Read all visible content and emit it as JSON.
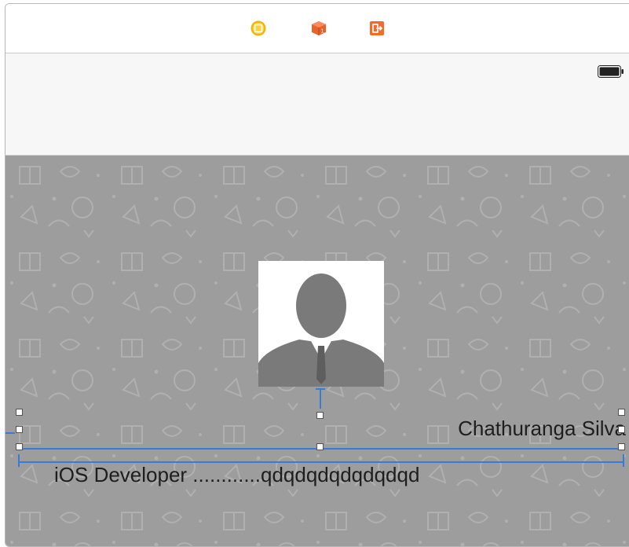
{
  "scene_dock": {
    "icons": [
      "view-controller-icon",
      "first-responder-icon",
      "exit-icon"
    ]
  },
  "status_bar": {
    "battery": "battery-icon"
  },
  "content": {
    "profile_image": "person-silhouette-icon",
    "name_label": "Chathuranga Silva",
    "title_label": "iOS Developer ............qdqdqdqdqdqdqd"
  },
  "colors": {
    "accent": "#3a7bd5",
    "view_controller": "#f5b400",
    "first_responder": "#e8622a",
    "exit": "#f26b2a",
    "background": "#9d9d9d",
    "silhouette": "#7a7a7a"
  }
}
